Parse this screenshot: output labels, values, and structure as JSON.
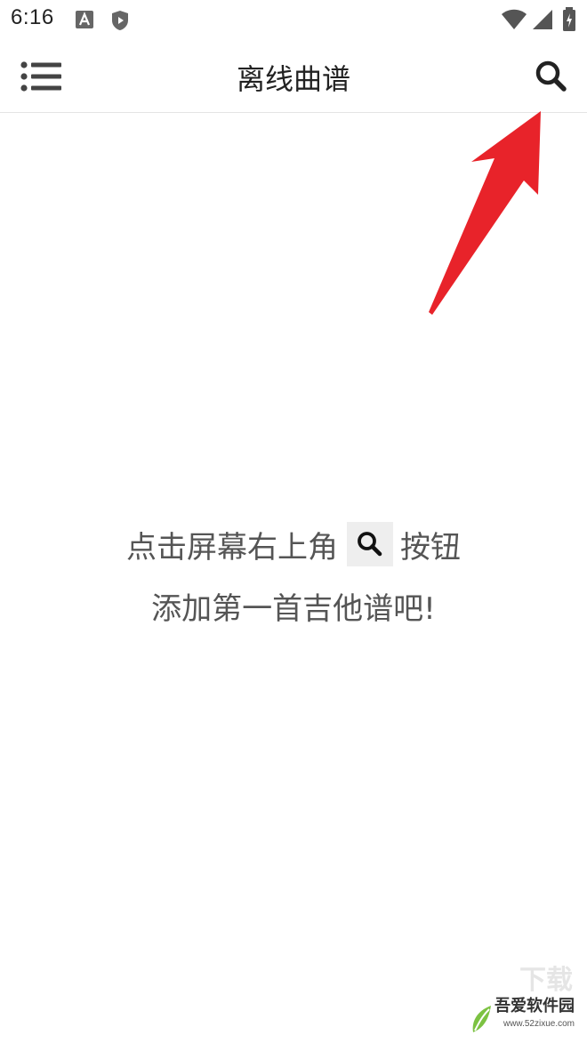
{
  "status_bar": {
    "time": "6:16",
    "icons": [
      "a-notification-icon",
      "shield-play-icon",
      "wifi-icon",
      "cellular-signal-icon",
      "battery-charging-icon"
    ]
  },
  "app_bar": {
    "title": "离线曲谱",
    "menu_icon": "list-menu-icon",
    "search_icon": "search-icon"
  },
  "empty_state": {
    "line1_before": "点击屏幕右上角",
    "line1_after": "按钮",
    "line2": "添加第一首吉他谱吧!"
  },
  "annotation": {
    "arrow_color": "#e8232a"
  },
  "watermark": {
    "title": "吾爱软件园",
    "url": "www.52zixue.com",
    "faint_text": "下载"
  },
  "colors": {
    "background": "#ffffff",
    "text_primary": "#222222",
    "text_secondary": "#555555",
    "icon_gray": "#555555"
  }
}
